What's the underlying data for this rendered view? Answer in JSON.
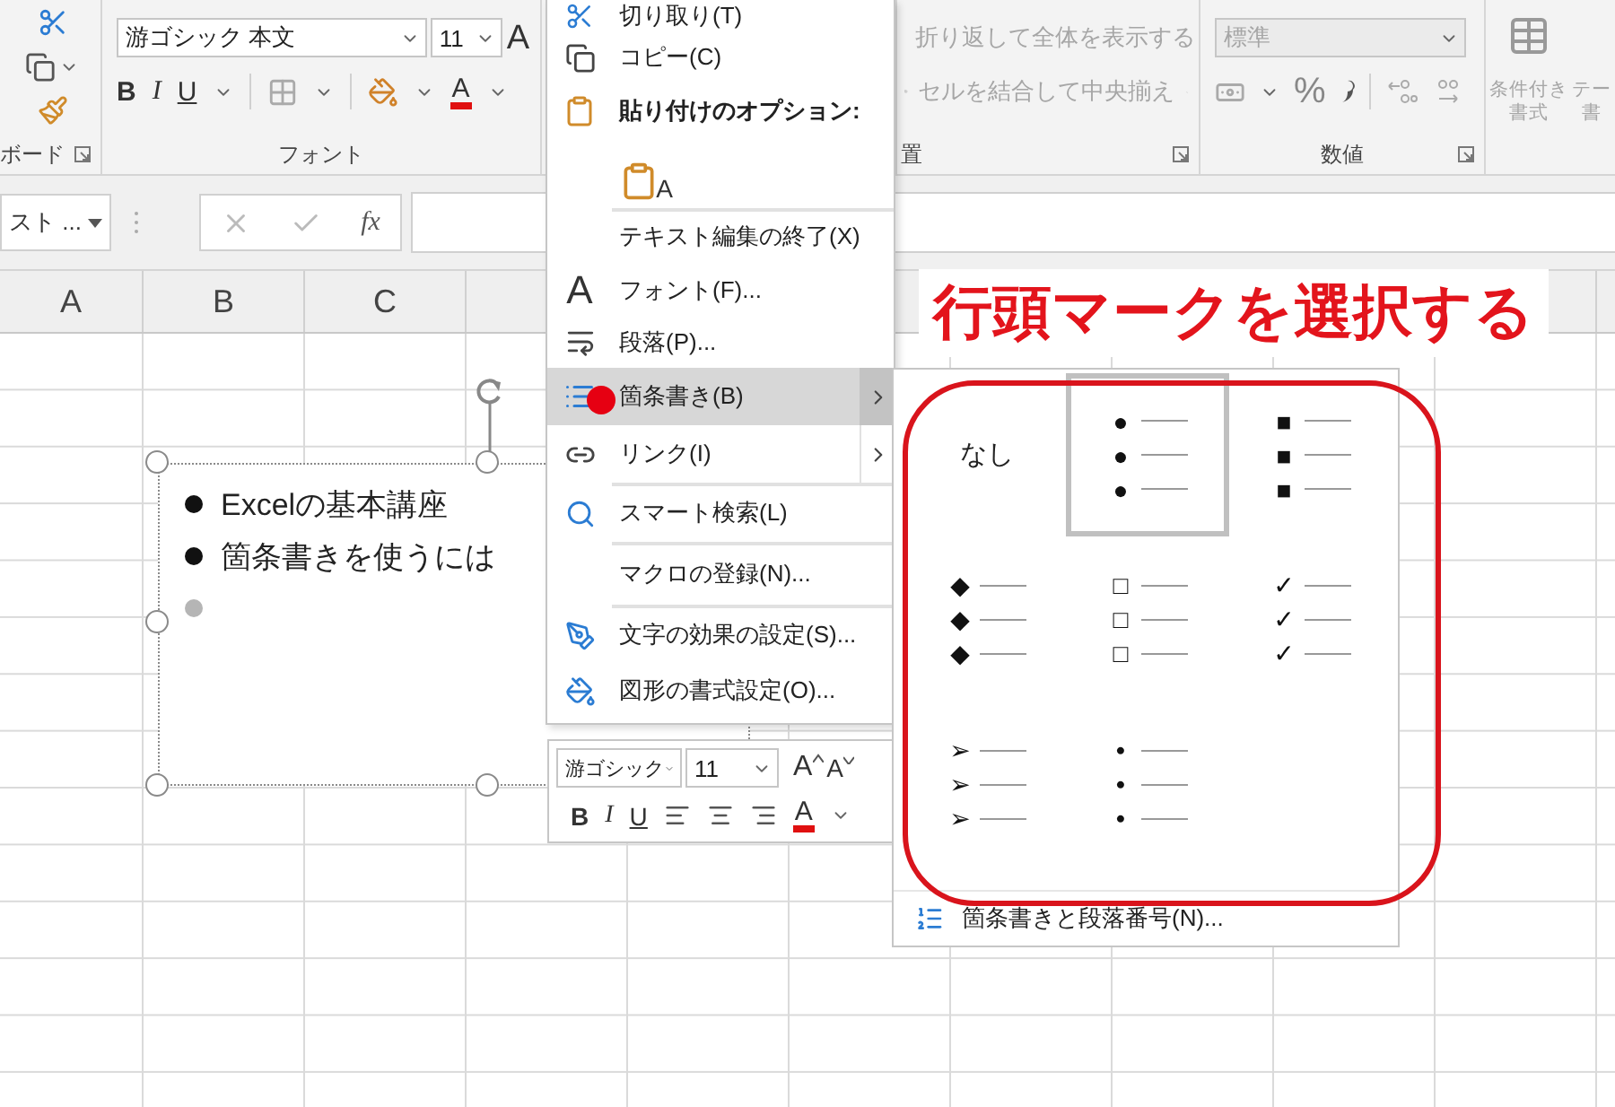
{
  "ribbon": {
    "clipboard": {
      "label": "ボード"
    },
    "font": {
      "font_name": "游ゴシック 本文",
      "font_size": "11",
      "grow_font": "A",
      "bold": "B",
      "italic": "I",
      "underline": "U",
      "font_color": "A",
      "label": "フォント"
    },
    "alignment": {
      "disabled": true,
      "wrap_text": "折り返して全体を表示する",
      "merge_center": "セルを結合して中央揃え",
      "label": "置"
    },
    "number": {
      "disabled": true,
      "format": "標準",
      "percent": "%",
      "label": "数値"
    },
    "styles": {
      "disabled": true,
      "conditional_format": [
        "条件付き",
        "書式"
      ],
      "table_format": [
        "テー",
        "書"
      ]
    }
  },
  "formula_bar": {
    "name_box": "スト ...",
    "function_label": "fx"
  },
  "columns": [
    "A",
    "B",
    "C"
  ],
  "text_box": {
    "lines": [
      {
        "kind": "filled",
        "text": "Excelの基本講座"
      },
      {
        "kind": "filled",
        "text": "箇条書きを使うには"
      },
      {
        "kind": "empty"
      }
    ]
  },
  "context_menu": {
    "items": [
      {
        "kind": "command",
        "label": "切り取り(T)",
        "selected": false,
        "submenu": false,
        "separator_above": false
      },
      {
        "kind": "command",
        "label": "コピー(C)",
        "selected": false,
        "submenu": false,
        "separator_above": false
      },
      {
        "kind": "heading",
        "label": "貼り付けのオプション:",
        "selected": false,
        "submenu": false,
        "separator_above": false
      },
      {
        "kind": "paste_option",
        "glyph": "A",
        "selected": false
      },
      {
        "kind": "command",
        "label": "テキスト編集の終了(X)",
        "selected": false,
        "submenu": false,
        "separator_above": true
      },
      {
        "kind": "command",
        "label": "フォント(F)...",
        "icon_text": "A",
        "selected": false,
        "submenu": false,
        "separator_above": false
      },
      {
        "kind": "command",
        "label": "段落(P)...",
        "selected": false,
        "submenu": false,
        "separator_above": false
      },
      {
        "kind": "command",
        "label": "箇条書き(B)",
        "selected": true,
        "submenu": true,
        "separator_above": false
      },
      {
        "kind": "command",
        "label": "リンク(I)",
        "selected": false,
        "submenu": true,
        "separator_above": false
      },
      {
        "kind": "command",
        "label": "スマート検索(L)",
        "selected": false,
        "submenu": false,
        "separator_above": true
      },
      {
        "kind": "command",
        "label": "マクロの登録(N)...",
        "selected": false,
        "submenu": false,
        "separator_above": true
      },
      {
        "kind": "command",
        "label": "文字の効果の設定(S)...",
        "selected": false,
        "submenu": false,
        "separator_above": true
      },
      {
        "kind": "command",
        "label": "図形の書式設定(O)...",
        "selected": false,
        "submenu": false,
        "separator_above": false
      }
    ]
  },
  "mini_toolbar": {
    "font_name": "游ゴシック",
    "font_size": "11",
    "grow_font": "A",
    "shrink_font": "A",
    "bold": "B",
    "italic": "I",
    "underline": "U",
    "font_color": "A"
  },
  "bullet_gallery": {
    "options": [
      {
        "kind": "none",
        "label": "なし",
        "selected": false
      },
      {
        "kind": "symbol",
        "symbols": [
          "●",
          "●",
          "●"
        ],
        "selected": true
      },
      {
        "kind": "symbol",
        "symbols": [
          "■",
          "■",
          "■"
        ],
        "selected": false
      },
      {
        "kind": "symbol",
        "symbols": [
          "◆",
          "◆",
          "◆"
        ],
        "selected": false
      },
      {
        "kind": "symbol",
        "symbols": [
          "□",
          "□",
          "□"
        ],
        "selected": false
      },
      {
        "kind": "symbol",
        "symbols": [
          "✓",
          "✓",
          "✓"
        ],
        "selected": false
      },
      {
        "kind": "symbol",
        "symbols": [
          "➢",
          "➢",
          "➢"
        ],
        "selected": false
      },
      {
        "kind": "symbol",
        "symbols": [
          "•",
          "•",
          "•"
        ],
        "selected": false
      }
    ],
    "footer": "箇条書きと段落番号(N)..."
  },
  "annotation": {
    "title": "行頭マークを選択する"
  }
}
